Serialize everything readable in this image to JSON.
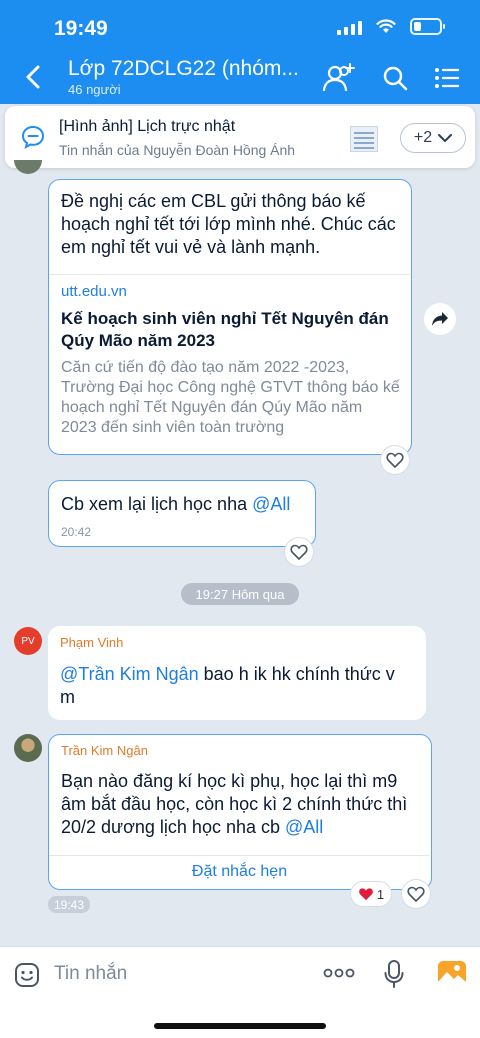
{
  "status": {
    "time": "19:49"
  },
  "header": {
    "title": "Lớp 72DCLG22 (nhóm...",
    "member_count": "46 người"
  },
  "pinned": {
    "title": "[Hình ảnh] Lịch trực nhật",
    "subtitle": "Tin nhắn của Nguyễn Đoàn Hồng Ánh",
    "more": "+2"
  },
  "messages": {
    "m1": {
      "text": "Đề nghị các em CBL gửi thông báo kế hoạch nghỉ tết tới lớp mình nhé. Chúc các em nghỉ tết vui vẻ và lành mạnh.",
      "link_host": "utt.edu.vn",
      "link_title": "Kế hoạch sinh viên nghỉ Tết Nguyên đán Qúy Mão năm 2023",
      "link_desc": "Căn cứ tiến độ đào tạo năm 2022 -2023, Trường Đại học Công nghệ GTVT thông báo kế hoạch nghỉ Tết Nguyên đán Qúy Mão năm 2023 đến sinh viên toàn trường"
    },
    "m2": {
      "text": "Cb xem lại lịch học nha ",
      "mention": "@All",
      "time": "20:42"
    },
    "date_divider": "19:27 Hôm qua",
    "m3": {
      "avatar_initials": "PV",
      "sender": "Phạm Vinh",
      "mention": "@Trần Kim Ngân",
      "text": " bao h ik hk chính thức v m"
    },
    "m4": {
      "sender": "Trần Kim Ngân",
      "text": "Bạn nào đăng kí học kì phụ, học lại thì m9 âm bắt đầu học, còn học kì 2 chính thức thì 20/2 dương lịch học nha cb ",
      "mention": "@All",
      "action": "Đặt nhắc hẹn",
      "reaction_count": "1",
      "time": "19:43"
    }
  },
  "input": {
    "placeholder": "Tin nhắn"
  },
  "colors": {
    "header": "#1d8df2",
    "mention": "#1f7ee3",
    "sender": "#e07b2a",
    "background": "#e2e8ef"
  }
}
